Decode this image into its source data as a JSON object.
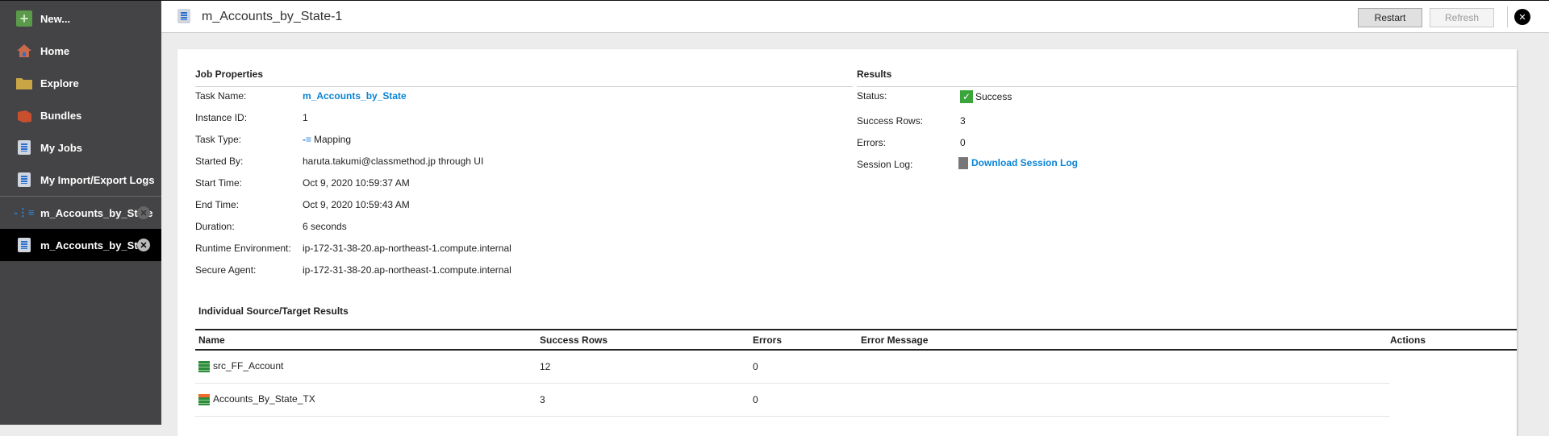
{
  "sidebar": {
    "items": [
      {
        "label": "New...",
        "icon": "plus-icon"
      },
      {
        "label": "Home",
        "icon": "home-icon"
      },
      {
        "label": "Explore",
        "icon": "folder-icon"
      },
      {
        "label": "Bundles",
        "icon": "bundle-icon"
      },
      {
        "label": "My Jobs",
        "icon": "jobs-icon"
      },
      {
        "label": "My Import/Export Logs",
        "icon": "logs-icon"
      }
    ],
    "open_tabs": [
      {
        "label": "m_Accounts_by_State",
        "icon": "mapping-icon"
      },
      {
        "label": "m_Accounts_by_St...",
        "icon": "job-icon"
      }
    ],
    "close_glyph": "✕"
  },
  "header": {
    "title": "m_Accounts_by_State-1",
    "restart": "Restart",
    "refresh": "Refresh",
    "close_glyph": "✕"
  },
  "job_properties": {
    "heading": "Job Properties",
    "rows": [
      {
        "label": "Task Name:",
        "value": "m_Accounts_by_State"
      },
      {
        "label": "Instance ID:",
        "value": "1"
      },
      {
        "label": "Task Type:",
        "value": "Mapping"
      },
      {
        "label": "Started By:",
        "value": "haruta.takumi@classmethod.jp through UI"
      },
      {
        "label": "Start Time:",
        "value": "Oct 9, 2020 10:59:37 AM"
      },
      {
        "label": "End Time:",
        "value": "Oct 9, 2020 10:59:43 AM"
      },
      {
        "label": "Duration:",
        "value": "6 seconds"
      },
      {
        "label": "Runtime Environment:",
        "value": "ip-172-31-38-20.ap-northeast-1.compute.internal"
      },
      {
        "label": "Secure Agent:",
        "value": "ip-172-31-38-20.ap-northeast-1.compute.internal"
      }
    ]
  },
  "results": {
    "heading": "Results",
    "rows": [
      {
        "label": "Status:",
        "value": "Success"
      },
      {
        "label": "Success Rows:",
        "value": "3"
      },
      {
        "label": "Errors:",
        "value": "0"
      },
      {
        "label": "Session Log:",
        "value": "Download Session Log"
      }
    ],
    "check_glyph": "✓"
  },
  "individual": {
    "heading": "Individual Source/Target Results",
    "columns": [
      "Name",
      "Success Rows",
      "Errors",
      "Error Message",
      "Actions"
    ],
    "rows": [
      {
        "name": "src_FF_Account",
        "success": "12",
        "errors": "0",
        "message": ""
      },
      {
        "name": "Accounts_By_State_TX",
        "success": "3",
        "errors": "0",
        "message": ""
      }
    ]
  },
  "colors": {
    "link": "#0a84d6",
    "success": "#3aa53a",
    "sidebar": "#444446"
  }
}
